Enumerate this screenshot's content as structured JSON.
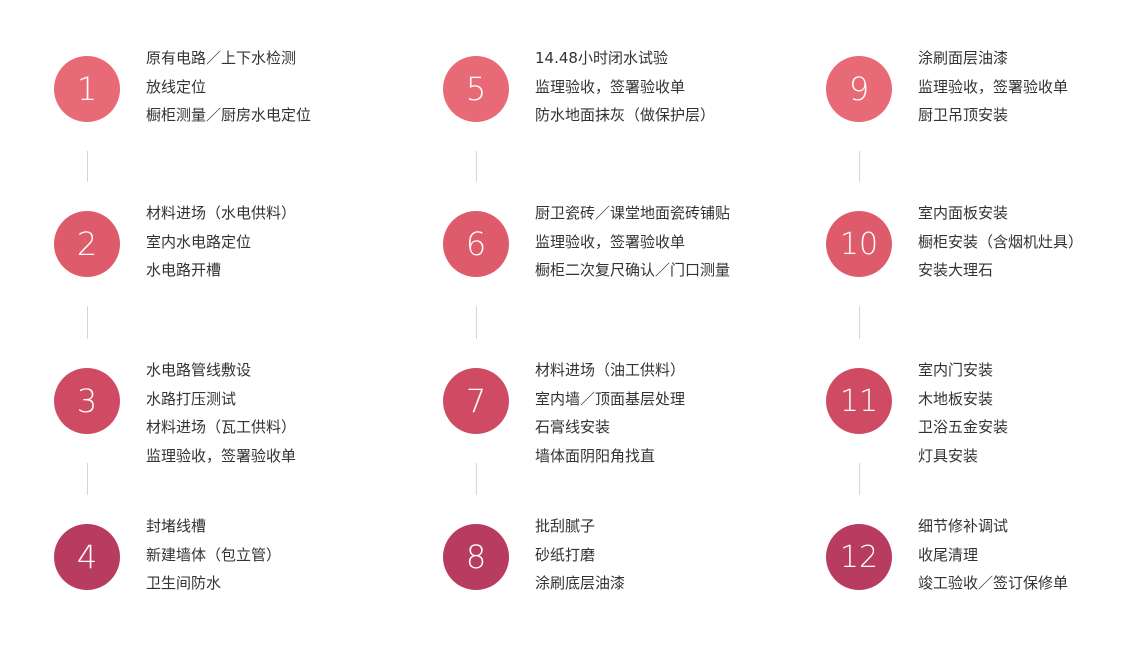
{
  "colors": [
    "#e96a77",
    "#de5b6b",
    "#cf4b64",
    "#b83c5f"
  ],
  "steps": [
    {
      "num": "1",
      "lines": [
        "原有电路／上下水检测",
        "放线定位",
        "橱柜测量／厨房水电定位"
      ]
    },
    {
      "num": "2",
      "lines": [
        "材料进场（水电供料）",
        "室内水电路定位",
        "水电路开槽"
      ]
    },
    {
      "num": "3",
      "lines": [
        "水电路管线敷设",
        "水路打压测试",
        "材料进场（瓦工供料）",
        "监理验收，签署验收单"
      ]
    },
    {
      "num": "4",
      "lines": [
        "封堵线槽",
        "新建墙体（包立管）",
        "卫生间防水"
      ]
    },
    {
      "num": "5",
      "lines": [
        "14.48小时闭水试验",
        "监理验收，签署验收单",
        "防水地面抹灰（做保护层）"
      ]
    },
    {
      "num": "6",
      "lines": [
        "厨卫瓷砖／课堂地面瓷砖铺贴",
        "监理验收，签署验收单",
        "橱柜二次复尺确认／门口测量"
      ]
    },
    {
      "num": "7",
      "lines": [
        "材料进场（油工供料）",
        "室内墙／顶面基层处理",
        "石膏线安装",
        "墙体面阴阳角找直"
      ]
    },
    {
      "num": "8",
      "lines": [
        "批刮腻子",
        "砂纸打磨",
        "涂刷底层油漆"
      ]
    },
    {
      "num": "9",
      "lines": [
        "涂刷面层油漆",
        "监理验收，签署验收单",
        "厨卫吊顶安装"
      ]
    },
    {
      "num": "10",
      "lines": [
        "室内面板安装",
        "橱柜安装（含烟机灶具）",
        "安装大理石"
      ]
    },
    {
      "num": "11",
      "lines": [
        "室内门安装",
        "木地板安装",
        "卫浴五金安装",
        "灯具安装"
      ]
    },
    {
      "num": "12",
      "lines": [
        "细节修补调试",
        "收尾清理",
        "竣工验收／签订保修单"
      ]
    }
  ]
}
